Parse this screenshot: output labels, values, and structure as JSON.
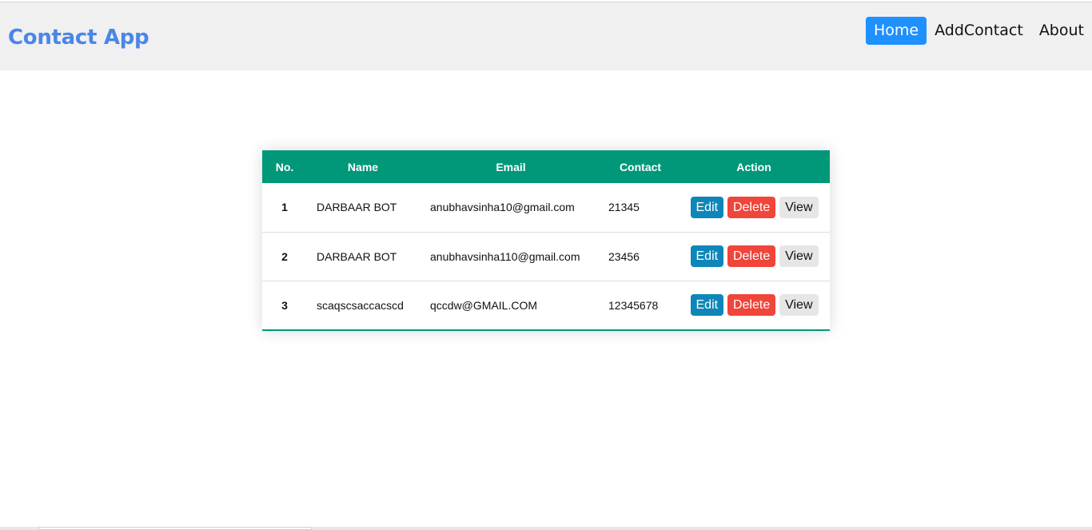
{
  "app": {
    "brand": "Contact App"
  },
  "nav": {
    "items": [
      {
        "label": "Home",
        "active": true
      },
      {
        "label": "AddContact",
        "active": false
      },
      {
        "label": "About",
        "active": false
      }
    ]
  },
  "table": {
    "headers": [
      "No.",
      "Name",
      "Email",
      "Contact",
      "Action"
    ],
    "rows": [
      {
        "no": "1",
        "name": "DARBAAR BOT",
        "email": "anubhavsinha10@gmail.com",
        "contact": "21345"
      },
      {
        "no": "2",
        "name": "DARBAAR BOT",
        "email": "anubhavsinha110@gmail.com",
        "contact": "23456"
      },
      {
        "no": "3",
        "name": "scaqscsaccacscd",
        "email": "qccdw@GMAIL.COM",
        "contact": "12345678"
      }
    ],
    "actions": {
      "edit": "Edit",
      "delete": "Delete",
      "view": "View"
    }
  },
  "colors": {
    "brand": "#4a86e8",
    "nav_active": "#1e90ff",
    "table_header": "#009879",
    "edit": "#0e86b8",
    "delete": "#f0453a",
    "view": "#e6e6e6"
  }
}
